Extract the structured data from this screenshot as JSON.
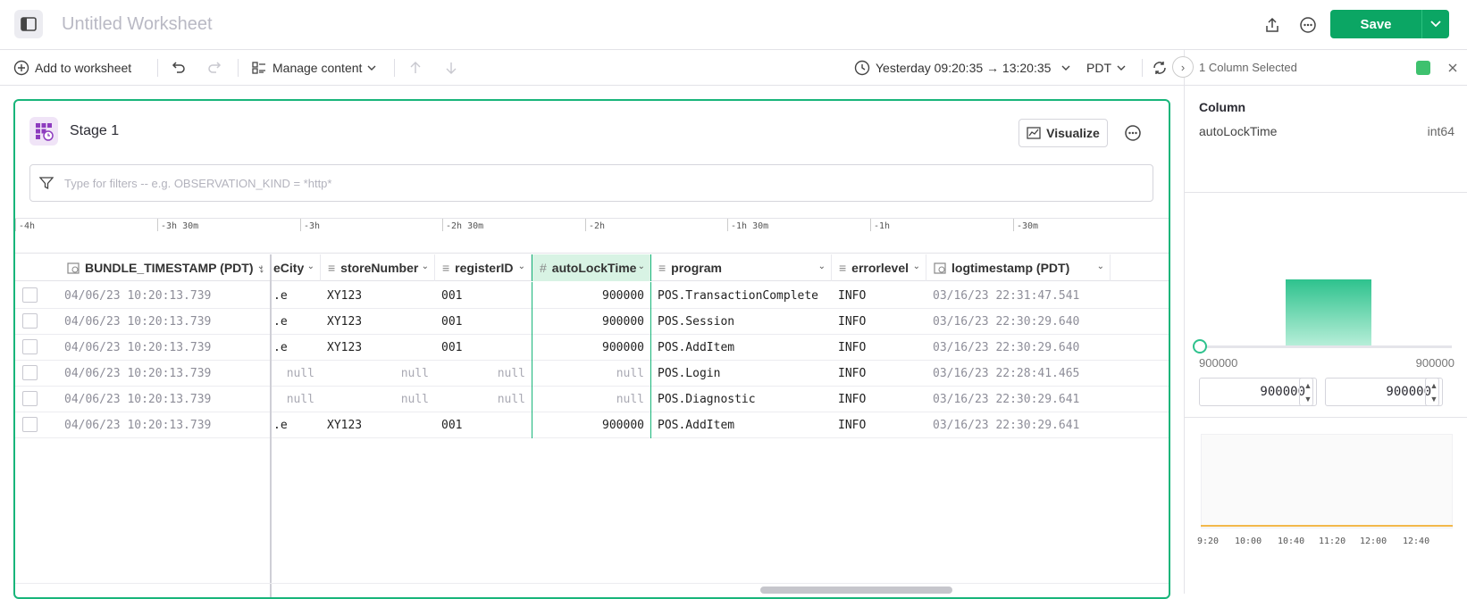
{
  "header": {
    "title": "Untitled Worksheet",
    "save_label": "Save"
  },
  "toolbar": {
    "add_to_worksheet": "Add to worksheet",
    "manage_content": "Manage content",
    "time_range": "Yesterday 09:20:35 → 13:20:35",
    "timezone": "PDT"
  },
  "panel": {
    "title": "1 Column Selected",
    "color": "#3ec16e",
    "column_label": "Column",
    "column_name": "autoLockTime",
    "column_type": "int64",
    "range_min_label": "900000",
    "range_max_label": "900000",
    "min_value": "900000",
    "max_value": "900000",
    "spark_ticks": [
      "9:20",
      "10:00",
      "10:40",
      "11:20",
      "12:00",
      "12:40"
    ]
  },
  "stage": {
    "title": "Stage 1",
    "visualize_label": "Visualize",
    "filter_placeholder": "Type for filters -- e.g. OBSERVATION_KIND = *http*"
  },
  "timeline": [
    "-4h",
    "-3h 30m",
    "-3h",
    "-2h 30m",
    "-2h",
    "-1h 30m",
    "-1h",
    "-30m"
  ],
  "table": {
    "columns": [
      "BUNDLE_TIMESTAMP (PDT)",
      "eCity",
      "storeNumber",
      "registerID",
      "autoLockTime",
      "program",
      "errorlevel",
      "logtimestamp (PDT)"
    ],
    "rows": [
      [
        "04/06/23 10:20:13.739",
        ".e",
        "XY123",
        "001",
        "900000",
        "POS.TransactionComplete",
        "INFO",
        "03/16/23 22:31:47.541"
      ],
      [
        "04/06/23 10:20:13.739",
        ".e",
        "XY123",
        "001",
        "900000",
        "POS.Session",
        "INFO",
        "03/16/23 22:30:29.640"
      ],
      [
        "04/06/23 10:20:13.739",
        ".e",
        "XY123",
        "001",
        "900000",
        "POS.AddItem",
        "INFO",
        "03/16/23 22:30:29.640"
      ],
      [
        "04/06/23 10:20:13.739",
        "null",
        "null",
        "null",
        "null",
        "POS.Login",
        "INFO",
        "03/16/23 22:28:41.465"
      ],
      [
        "04/06/23 10:20:13.739",
        "null",
        "null",
        "null",
        "null",
        "POS.Diagnostic",
        "INFO",
        "03/16/23 22:30:29.641"
      ],
      [
        "04/06/23 10:20:13.739",
        ".e",
        "XY123",
        "001",
        "900000",
        "POS.AddItem",
        "INFO",
        "03/16/23 22:30:29.641"
      ]
    ]
  }
}
